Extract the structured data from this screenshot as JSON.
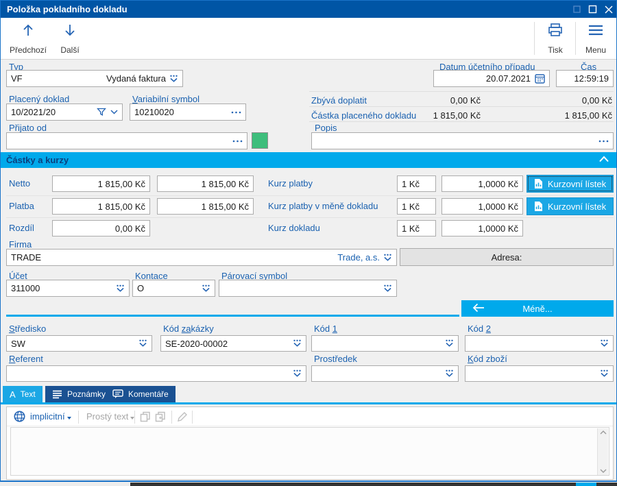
{
  "window": {
    "title": "Položka pokladního dokladu"
  },
  "toolbar": {
    "previous": "Předchozí",
    "next": "Další",
    "print": "Tisk",
    "menu": "Menu"
  },
  "fields": {
    "typ": {
      "label": {
        "pre": "",
        "key": "T",
        "post": "yp"
      },
      "code": "VF",
      "name": "Vydaná faktura"
    },
    "datum": {
      "label": {
        "pre": "Dat",
        "key": "u",
        "post": "m účetního případu"
      },
      "value": "20.07.2021"
    },
    "cas": {
      "label": "Čas",
      "value": "12:59:19"
    },
    "placeny": {
      "label": "Placený doklad",
      "value": "10/2021/20"
    },
    "varsym": {
      "label": {
        "pre": "",
        "key": "V",
        "post": "ariabilní symbol"
      },
      "value": "10210020"
    },
    "zbyva": {
      "label": "Zbývá doplatit",
      "mid": "0,00 Kč",
      "right": "0,00 Kč"
    },
    "castka": {
      "label": "Částka placeného dokladu",
      "mid": "1 815,00 Kč",
      "right": "1 815,00 Kč"
    },
    "prijato": {
      "label": "Přijato od",
      "value": ""
    },
    "popis": {
      "label": "Popis",
      "value": ""
    },
    "firma": {
      "label": "Firma",
      "code": "TRADE",
      "name": "Trade, a.s."
    },
    "adresa": {
      "label": "Adresa:"
    },
    "ucet": {
      "label": {
        "pre": "Úč",
        "key": "e",
        "post": "t"
      },
      "value": "311000"
    },
    "kontace": {
      "label": {
        "pre": "Konta",
        "key": "c",
        "post": "e"
      },
      "value": "O"
    },
    "parovaci": {
      "label": "Párovací symbol",
      "value": ""
    },
    "stredisko": {
      "label": {
        "pre": "",
        "key": "S",
        "post": "tředisko"
      },
      "value": "SW"
    },
    "kod_zakazky": {
      "label": {
        "pre": "Kód ",
        "key": "za",
        "post": "kázky"
      },
      "value": "SE-2020-00002"
    },
    "kod1": {
      "label": {
        "pre": "Kód ",
        "key": "1",
        "post": ""
      },
      "value": ""
    },
    "kod2": {
      "label": {
        "pre": "Kód ",
        "key": "2",
        "post": ""
      },
      "value": ""
    },
    "referent": {
      "label": {
        "pre": "",
        "key": "R",
        "post": "eferent"
      },
      "value": ""
    },
    "prostredek": {
      "label": "Prostředek",
      "value": ""
    },
    "kod_zbozi": {
      "label": {
        "pre": "",
        "key": "K",
        "post": "ód zboží"
      },
      "value": ""
    }
  },
  "section": {
    "title": "Částky a kurzy",
    "rows": [
      {
        "label": "Netto",
        "v1": "1 815,00 Kč",
        "v2": "1 815,00 Kč",
        "kurz": "Kurz platby",
        "k1": "1 Kč",
        "k2": "1,0000 Kč",
        "btn": "Kurzovní lístek"
      },
      {
        "label": "Platba",
        "v1": "1 815,00 Kč",
        "v2": "1 815,00 Kč",
        "kurz": "Kurz platby v měně dokladu",
        "k1": "1 Kč",
        "k2": "1,0000 Kč",
        "btn": "Kurzovní lístek"
      },
      {
        "label": "Rozdíl",
        "v1": "0,00 Kč",
        "kurz": "Kurz dokladu",
        "k1": "1 Kč",
        "k2": "1,0000 Kč"
      }
    ]
  },
  "mene_button": "Méně...",
  "tabs": {
    "text": {
      "label": "Text",
      "icon_char": "A"
    },
    "poznamky": {
      "label": "Poznámky"
    },
    "komentare": {
      "label": "Komentáře"
    }
  },
  "editor": {
    "lang": "implicitní",
    "format": "Prostý text"
  },
  "colors": {
    "titlebar": "#0055A5",
    "accent_cyan": "#00A9EB",
    "tab_inactive": "#1A5192",
    "label_blue": "#1A61B0",
    "icon_blue": "#2464B4",
    "green_button": "#3EBE7C"
  }
}
